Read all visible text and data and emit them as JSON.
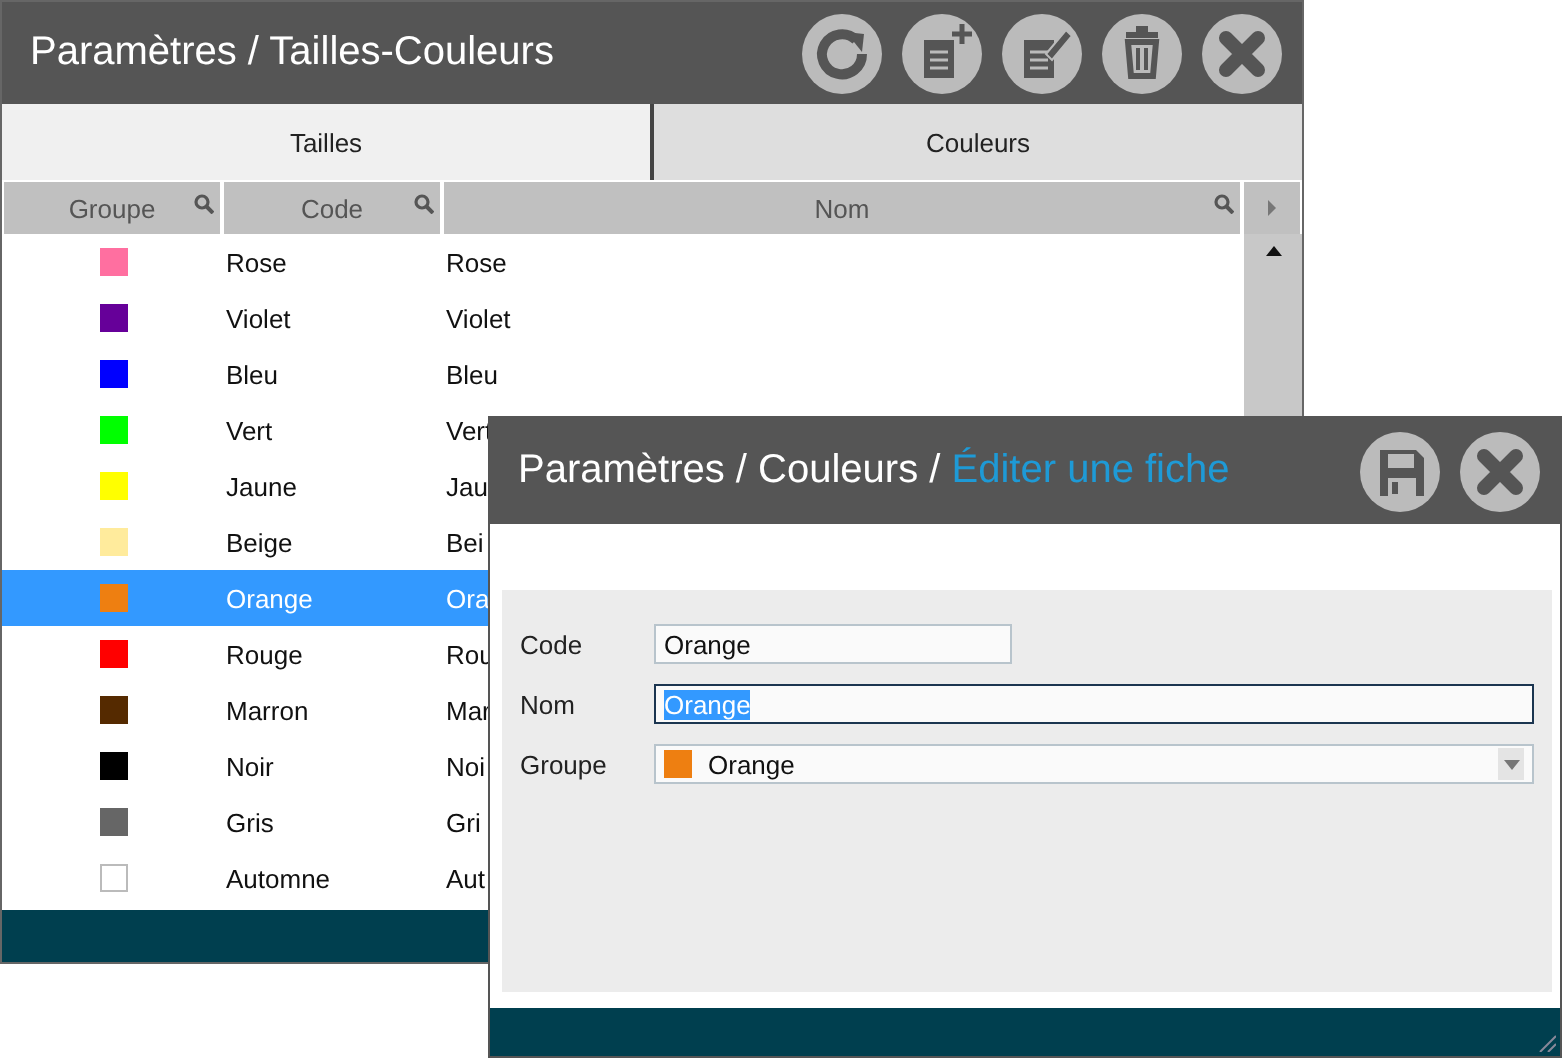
{
  "main_window": {
    "title": "Paramètres / Tailles-Couleurs",
    "tabs": [
      {
        "label": "Tailles",
        "selected": false
      },
      {
        "label": "Couleurs",
        "selected": true
      }
    ],
    "columns": [
      "Groupe",
      "Code",
      "Nom"
    ],
    "rows": [
      {
        "color": "#ff6fa0",
        "code": "Rose",
        "name": "Rose",
        "selected": false
      },
      {
        "color": "#660099",
        "code": "Violet",
        "name": "Violet",
        "selected": false
      },
      {
        "color": "#0000ff",
        "code": "Bleu",
        "name": "Bleu",
        "selected": false
      },
      {
        "color": "#00ff00",
        "code": "Vert",
        "name": "Vert",
        "selected": false
      },
      {
        "color": "#ffff00",
        "code": "Jaune",
        "name": "Jau",
        "selected": false
      },
      {
        "color": "#ffeb9c",
        "code": "Beige",
        "name": "Bei",
        "selected": false
      },
      {
        "color": "#ee7f11",
        "code": "Orange",
        "name": "Ora",
        "selected": true
      },
      {
        "color": "#ff0000",
        "code": "Rouge",
        "name": "Rou",
        "selected": false
      },
      {
        "color": "#552a00",
        "code": "Marron",
        "name": "Mar",
        "selected": false
      },
      {
        "color": "#000000",
        "code": "Noir",
        "name": "Noi",
        "selected": false
      },
      {
        "color": "#666666",
        "code": "Gris",
        "name": "Gri",
        "selected": false
      },
      {
        "color": "#ffffff",
        "code": "Automne",
        "name": "Aut",
        "selected": false
      }
    ]
  },
  "dialog": {
    "title": "Paramètres / Couleurs /",
    "subtitle": "Éditer une fiche",
    "fields": [
      {
        "kind": "text",
        "label": "Code",
        "value": "Orange",
        "focused": false
      },
      {
        "kind": "text",
        "label": "Nom",
        "value": "Orange",
        "focused": true
      },
      {
        "kind": "select",
        "label": "Groupe",
        "value": "Orange",
        "color": "#ee7f11"
      }
    ]
  }
}
